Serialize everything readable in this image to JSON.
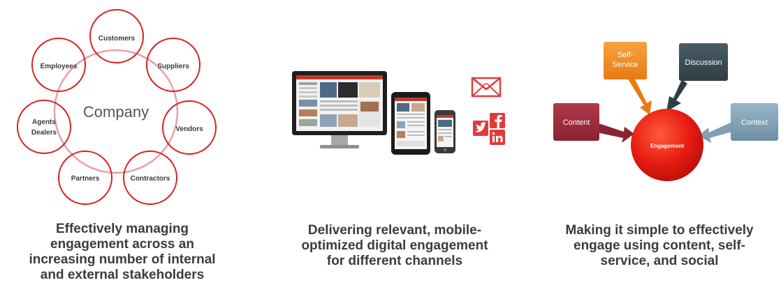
{
  "stakeholders": {
    "center": "Company",
    "nodes": [
      {
        "lines": [
          "Customers"
        ]
      },
      {
        "lines": [
          "Suppliers"
        ]
      },
      {
        "lines": [
          "Vendors"
        ]
      },
      {
        "lines": [
          "Contractors"
        ]
      },
      {
        "lines": [
          "Partners"
        ]
      },
      {
        "lines": [
          "Agents",
          "Dealers"
        ]
      },
      {
        "lines": [
          "Employees"
        ]
      }
    ],
    "caption": [
      "Effectively managing",
      "engagement across an",
      "increasing number of internal",
      "and external stakeholders"
    ]
  },
  "channels": {
    "caption": [
      "Delivering relevant, mobile-",
      "optimized digital engagement",
      "for different channels"
    ]
  },
  "engagement": {
    "center": "Engagement",
    "boxes": {
      "self_service": [
        "Self-",
        "Service"
      ],
      "discussion": "Discussion",
      "content": "Content",
      "context": "Context"
    },
    "caption": [
      "Making it simple to effectively",
      "engage using content, self-",
      "service, and social"
    ]
  },
  "colors": {
    "red": "#d82020",
    "orange": "#f28c1e",
    "darkteal": "#3b4a52",
    "maroon": "#9c2a3a",
    "steel": "#7f9fb4"
  }
}
